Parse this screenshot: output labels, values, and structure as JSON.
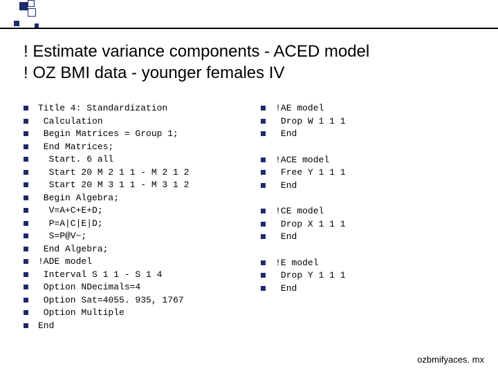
{
  "title_line1": "! Estimate variance components - ACED model",
  "title_line2": "! OZ BMI data - younger females IV",
  "left_col": [
    "Title 4: Standardization",
    " Calculation",
    " Begin Matrices = Group 1;",
    " End Matrices;",
    "  Start. 6 all",
    "  Start 20 M 2 1 1 - M 2 1 2",
    "  Start 20 M 3 1 1 - M 3 1 2",
    " Begin Algebra;",
    "  V=A+C+E+D;",
    "  P=A|C|E|D;",
    "  S=P@V~;",
    " End Algebra;",
    "!ADE model",
    " Interval S 1 1 - S 1 4",
    " Option NDecimals=4",
    " Option Sat=4055. 935, 1767",
    " Option Multiple",
    "End"
  ],
  "right_groups": [
    [
      "!AE model",
      " Drop W 1 1 1",
      " End"
    ],
    [
      "!ACE model",
      " Free Y 1 1 1",
      " End"
    ],
    [
      "!CE model",
      " Drop X 1 1 1",
      " End"
    ],
    [
      "!E model",
      " Drop Y 1 1 1",
      " End"
    ]
  ],
  "footer_note": "ozbmifyaces. mx",
  "bullet_color": "#1e2a6b"
}
